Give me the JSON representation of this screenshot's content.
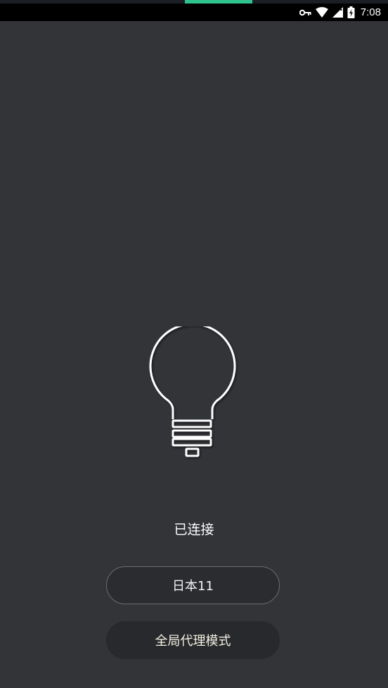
{
  "status_bar": {
    "time": "7:08",
    "icons": [
      "vpn-key-icon",
      "wifi-icon",
      "signal-icon",
      "battery-charging-icon"
    ]
  },
  "main": {
    "bulb_icon": "lightbulb-icon",
    "connection_status": "已连接",
    "server_button_label": "日本11",
    "mode_button_label": "全局代理模式"
  },
  "colors": {
    "background": "#333438",
    "status_bar": "#000000",
    "accent": "#2fc48f",
    "button_bg": "#2b2c2f",
    "text": "#ffffff"
  }
}
